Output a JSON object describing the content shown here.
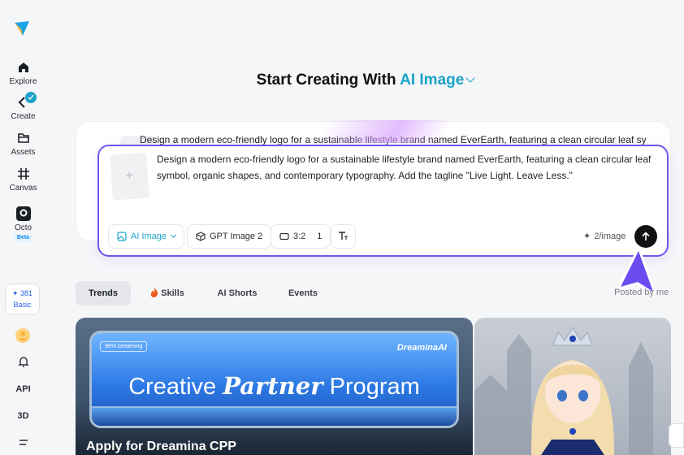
{
  "sidebar": {
    "items": [
      {
        "label": "Explore",
        "icon": "home-icon"
      },
      {
        "label": "Create",
        "icon": "create-icon"
      },
      {
        "label": "Assets",
        "icon": "folder-icon"
      },
      {
        "label": "Canvas",
        "icon": "canvas-icon"
      },
      {
        "label": "Octo",
        "icon": "octo-icon"
      }
    ],
    "beta": "Beta",
    "credits": {
      "amount": "381",
      "plan": "Basic"
    },
    "api": "API",
    "three_d": "3D"
  },
  "heading": {
    "prefix": "Start Creating With",
    "mode": "AI Image"
  },
  "background_prompt": "Design a modern eco-friendly logo for a sustainable lifestyle brand named EverEarth, featuring a clean circular leaf sy",
  "prompt": {
    "text": "Design a modern eco-friendly logo for a sustainable lifestyle brand named EverEarth, featuring a clean circular leaf symbol, organic shapes, and contemporary typography. Add the tagline \"Live Light. Leave Less.\"",
    "add_symbol": "+"
  },
  "toolbar": {
    "mode": "AI Image",
    "model": "GPT Image 2",
    "ratio": "3:2",
    "count": "1",
    "cost": "2/image"
  },
  "tabs": [
    {
      "label": "Trends",
      "active": true
    },
    {
      "label": "Skills",
      "active": false
    },
    {
      "label": "AI Shorts",
      "active": false
    },
    {
      "label": "Events",
      "active": false
    }
  ],
  "posted_by": "Posted by me",
  "cards": {
    "cpp": {
      "badge": "96% Dreaming",
      "brand": "DreaminaAI",
      "title_start": "Creative ",
      "title_italic": "Partner",
      "title_end": " Program",
      "caption": "Apply for Dreamina CPP"
    }
  },
  "colors": {
    "accent": "#1ba3c9",
    "prompt_border": "#6f55f0",
    "credit": "#2a63e8"
  }
}
